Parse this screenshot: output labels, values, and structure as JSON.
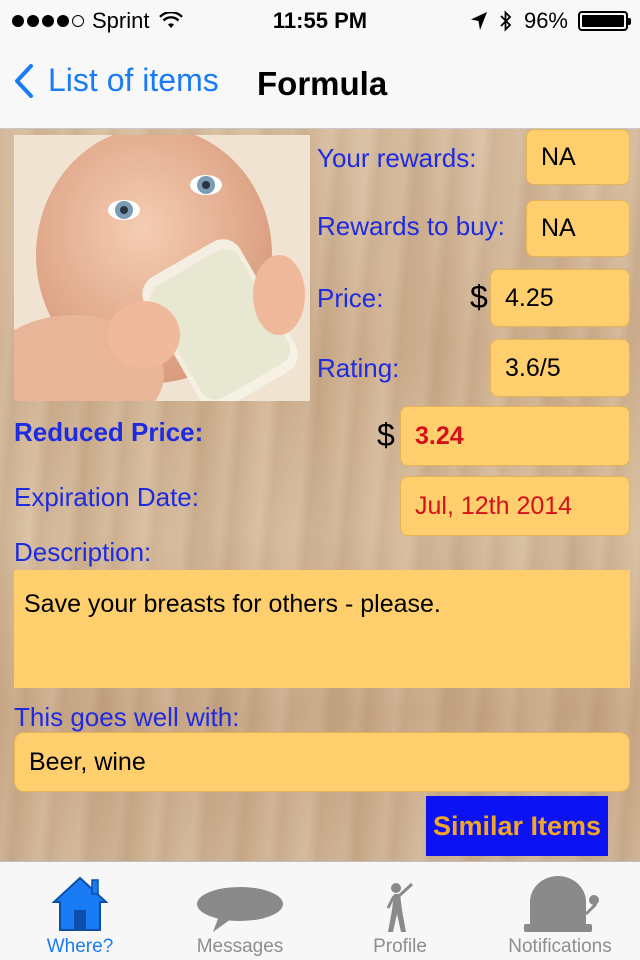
{
  "status_bar": {
    "carrier": "Sprint",
    "time": "11:55 PM",
    "battery": "96%",
    "battery_level": 0.96,
    "signal_bars": 4
  },
  "nav": {
    "back_label": "List of items",
    "title": "Formula"
  },
  "item": {
    "photo_subject": "baby-drinking-bottle",
    "your_rewards_label": "Your rewards:",
    "your_rewards_value": "NA",
    "rewards_to_buy_label": "Rewards to buy:",
    "rewards_to_buy_value": "NA",
    "price_label": "Price:",
    "price_currency": "$",
    "price_value": "4.25",
    "rating_label": "Rating:",
    "rating_value": "3.6/5",
    "reduced_price_label": "Reduced Price:",
    "reduced_price_currency": "$",
    "reduced_price_value": "3.24",
    "expiration_label": "Expiration Date:",
    "expiration_value": "Jul, 12th 2014",
    "description_label": "Description:",
    "description_value": "Save your breasts for others - please.",
    "goes_well_label": "This goes well with:",
    "goes_well_value": "Beer, wine",
    "similar_button": "Similar Items"
  },
  "tabs": [
    {
      "label": "Where?",
      "icon": "house-icon",
      "active": true
    },
    {
      "label": "Messages",
      "icon": "speech-bubble-icon",
      "active": false
    },
    {
      "label": "Profile",
      "icon": "person-icon",
      "active": false
    },
    {
      "label": "Notifications",
      "icon": "bell-icon",
      "active": false
    }
  ],
  "colors": {
    "accent": "#1a7cf5",
    "label_blue": "#1f2be0",
    "box_yellow": "#fecf6c",
    "red_value": "#d4111a",
    "button_blue": "#0c12f2",
    "button_text": "#f2a629"
  }
}
